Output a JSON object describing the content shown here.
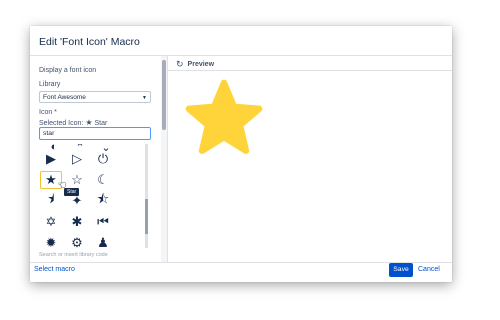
{
  "dialog": {
    "title": "Edit 'Font Icon' Macro"
  },
  "left": {
    "display_label": "Display a font icon",
    "library_label": "Library",
    "library_value": "Font Awesome",
    "icon_label": "Icon *",
    "selected_prefix": "Selected Icon:",
    "selected_icon_name": "Star",
    "search_value": "star",
    "tooltip": "Star",
    "faded_hint": "Search or insert library code"
  },
  "preview": {
    "title": "Preview",
    "star_color": "#ffd43b"
  },
  "icons": [
    {
      "name": "play-circle-icon",
      "glyph": "▶"
    },
    {
      "name": "play-circle-outline-icon",
      "glyph": "▷"
    },
    {
      "name": "power-icon",
      "glyph": "⏻"
    },
    {
      "name": "star-icon",
      "glyph": "★"
    },
    {
      "name": "star-outline-icon",
      "glyph": "☆"
    },
    {
      "name": "moon-star-icon",
      "glyph": "☾"
    },
    {
      "name": "star-half-icon",
      "glyph": "⯨"
    },
    {
      "name": "comment-icon",
      "glyph": "✦"
    },
    {
      "name": "star-half-outline-icon",
      "glyph": "⯪"
    },
    {
      "name": "star-of-david-icon",
      "glyph": "✡"
    },
    {
      "name": "asterisk-icon",
      "glyph": "✱"
    },
    {
      "name": "step-backward-icon",
      "glyph": "⏮"
    },
    {
      "name": "sun-icon",
      "glyph": "✹"
    },
    {
      "name": "cog-icon",
      "glyph": "⚙"
    },
    {
      "name": "users-icon",
      "glyph": "♟"
    }
  ],
  "footer": {
    "select_macro": "Select macro",
    "save": "Save",
    "cancel": "Cancel"
  },
  "colors": {
    "primary": "#0052cc",
    "selection_border": "#f1c232"
  }
}
